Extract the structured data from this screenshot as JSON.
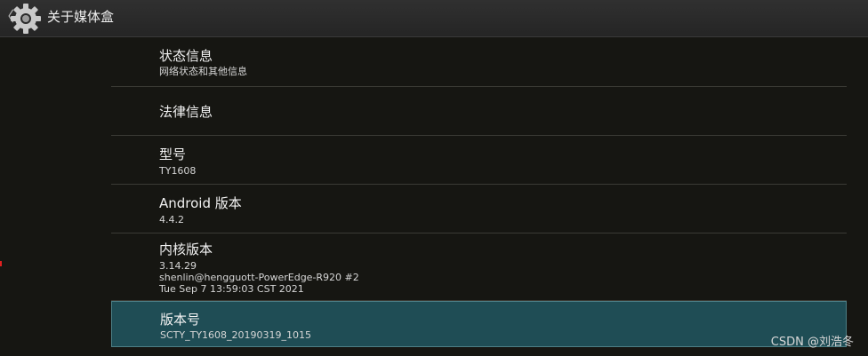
{
  "action_bar": {
    "title": "关于媒体盒",
    "back_glyph": "〈",
    "icon": "gear-icon"
  },
  "items": [
    {
      "title": "状态信息",
      "subtitle": "网络状态和其他信息"
    },
    {
      "title": "法律信息"
    },
    {
      "title": "型号",
      "subtitle": "TY1608"
    },
    {
      "title": "Android 版本",
      "subtitle": "4.4.2"
    },
    {
      "title": "内核版本",
      "lines": [
        "3.14.29",
        "shenlin@hengguott-PowerEdge-R920 #2",
        "Tue Sep 7 13:59:03 CST 2021"
      ]
    },
    {
      "title": "版本号",
      "subtitle": "SCTY_TY1608_20190319_1015",
      "selected": true
    }
  ],
  "watermark": "CSDN @刘浩冬",
  "colors": {
    "background": "#161612",
    "action_bar": "#2a2a2a",
    "selected_row": "#1f4d55",
    "divider": "#3b3b35"
  }
}
